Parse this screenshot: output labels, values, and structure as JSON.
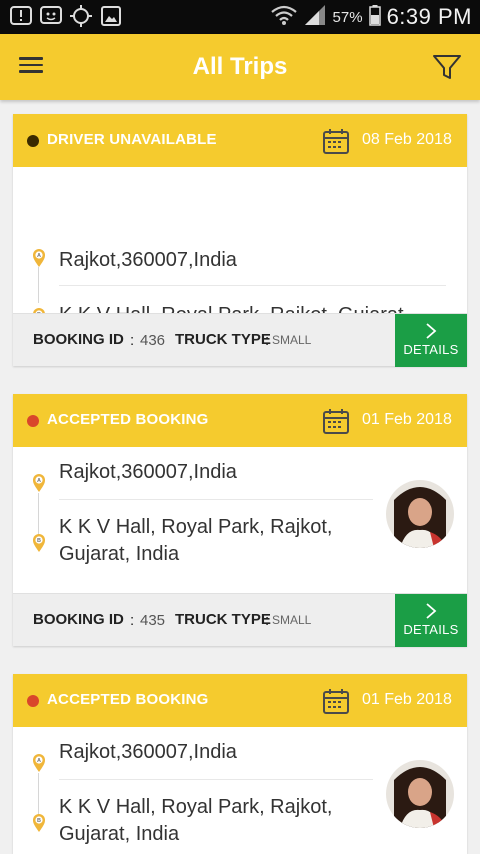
{
  "status_bar": {
    "battery": "57%",
    "time": "6:39 PM"
  },
  "app_bar": {
    "title": "All Trips"
  },
  "trips": [
    {
      "status": "DRIVER UNAVAILABLE",
      "status_color": "#3a2a00",
      "date": "08 Feb 2018",
      "pickup": "Rajkot,360007,India",
      "drop": "K K V Hall, Royal Park, Rajkot, Gujarat",
      "booking_id_label": "BOOKING ID",
      "booking_id": "436",
      "truck_type_label": "TRUCK TYPE",
      "truck_type": "SMALL",
      "details_label": "DETAILS"
    },
    {
      "status": "ACCEPTED BOOKING",
      "status_color": "#d9462b",
      "date": "01 Feb 2018",
      "pickup": "Rajkot,360007,India",
      "drop_line1": "K K V Hall, Royal Park, Rajkot,",
      "drop_line2": "Gujarat, India",
      "booking_id_label": "BOOKING ID",
      "booking_id": "435",
      "truck_type_label": "TRUCK TYPE",
      "truck_type": "SMALL",
      "details_label": "DETAILS"
    },
    {
      "status": "ACCEPTED BOOKING",
      "status_color": "#d9462b",
      "date": "01 Feb 2018",
      "pickup": "Rajkot,360007,India",
      "drop_line1": "K K V Hall, Royal Park, Rajkot,",
      "drop_line2": "Gujarat, India"
    }
  ],
  "colors": {
    "primary": "#f5cb2e",
    "details_button": "#1b9e46"
  }
}
